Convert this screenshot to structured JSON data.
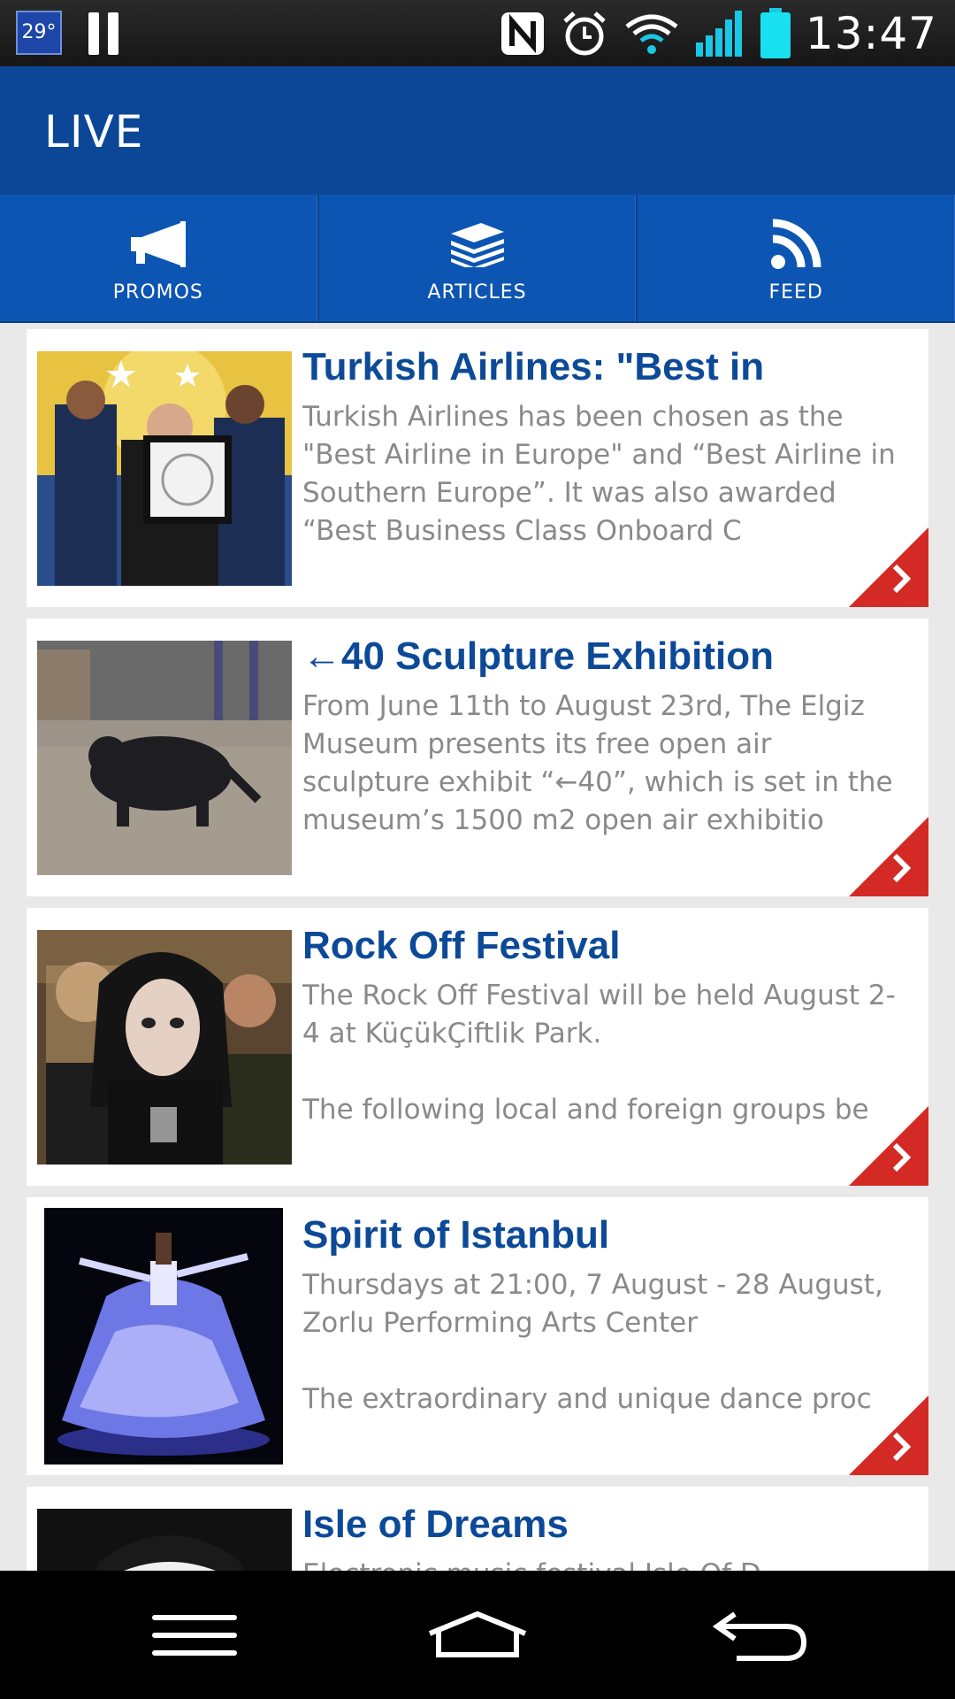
{
  "status_bar": {
    "weather_temp": "29°",
    "time": "13:47"
  },
  "app_bar": {
    "title": "LIVE"
  },
  "tabs": [
    {
      "label": "PROMOS",
      "icon": "megaphone-icon"
    },
    {
      "label": "ARTICLES",
      "icon": "stack-icon"
    },
    {
      "label": "FEED",
      "icon": "rss-icon"
    }
  ],
  "feed": {
    "items": [
      {
        "title": "Turkish Airlines: \"Best in",
        "description": "Turkish Airlines has been chosen as the \"Best Airline in Europe\" and “Best Airline in Southern Europe”.  It was also awarded “Best Business Class Onboard C",
        "image": "award-photo"
      },
      {
        "title": "←40 Sculpture Exhibition",
        "description": "From June 11th to August 23rd, The Elgiz Museum presents its free open air sculpture exhibit “←40”, which is set in the museum’s 1500 m2 open air exhibitio",
        "image": "sculpture-photo"
      },
      {
        "title": "Rock Off Festival",
        "description": "The Rock Off Festival will be held August 2-4 at KüçükÇiftlik Park.\n\nThe following local and foreign groups be",
        "image": "band-photo"
      },
      {
        "title": "Spirit of Istanbul",
        "description": "Thursdays at 21:00, 7 August - 28 August, Zorlu Performing Arts Center\n\nThe extraordinary and unique dance proc",
        "image": "dervish-photo"
      },
      {
        "title": "Isle of Dreams",
        "description": "Electronic music festival Isle Of D",
        "image": "portrait-photo"
      }
    ]
  },
  "colors": {
    "app_bar": "#0b4796",
    "tab_bar": "#0d55b2",
    "title_blue": "#0c4a98",
    "arrow_red": "#d42a25"
  }
}
